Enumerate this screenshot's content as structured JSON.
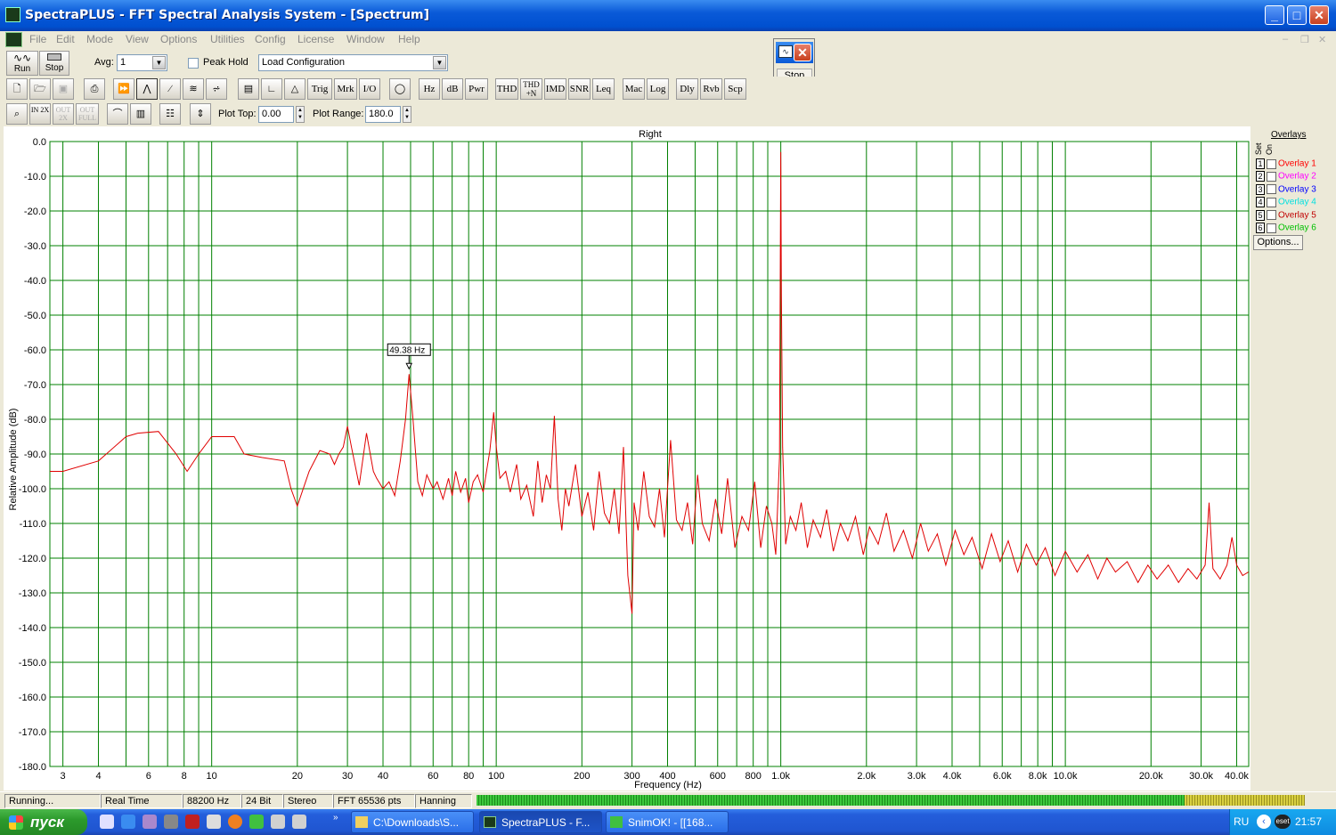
{
  "window": {
    "title": "SpectraPLUS - FFT Spectral Analysis System - [Spectrum]"
  },
  "menu": [
    "File",
    "Edit",
    "Mode",
    "View",
    "Options",
    "Utilities",
    "Config",
    "License",
    "Window",
    "Help"
  ],
  "toolbar1": {
    "run_label": "Run",
    "stop_label": "Stop",
    "avg_label": "Avg:",
    "avg_value": "1",
    "peak_hold_label": "Peak Hold",
    "config_value": "Load Configuration"
  },
  "toolbar2_buttons": [
    "Trig",
    "Mrk",
    "I/O",
    "Hz",
    "dB",
    "Pwr",
    "THD",
    "THD +N",
    "IMD",
    "SNR",
    "Leq",
    "Mac",
    "Log",
    "Dly",
    "Rvb",
    "Scp"
  ],
  "toolbar3": {
    "zoom_buttons": [
      "IN 2X",
      "OUT 2X",
      "OUT FULL"
    ],
    "plot_top_label": "Plot Top:",
    "plot_top_value": "0.00",
    "plot_range_label": "Plot Range:",
    "plot_range_value": "180.0"
  },
  "floating_stop": {
    "label": "Stop"
  },
  "overlays": {
    "header": "Overlays",
    "set_label": "Set",
    "on_label": "On",
    "items": [
      {
        "num": "1",
        "label": "Overlay 1",
        "color": "#ff0000"
      },
      {
        "num": "2",
        "label": "Overlay 2",
        "color": "#ff00ff"
      },
      {
        "num": "3",
        "label": "Overlay 3",
        "color": "#0000ff"
      },
      {
        "num": "4",
        "label": "Overlay 4",
        "color": "#00e0e0"
      },
      {
        "num": "5",
        "label": "Overlay 5",
        "color": "#c00000"
      },
      {
        "num": "6",
        "label": "Overlay 6",
        "color": "#00c000"
      }
    ],
    "options_label": "Options..."
  },
  "chart_data": {
    "type": "line",
    "title": "Right",
    "xlabel": "Frequency (Hz)",
    "ylabel": "Relative Amplitude (dB)",
    "xscale": "log",
    "xlim": [
      2.7,
      44100
    ],
    "ylim": [
      -180,
      0
    ],
    "grid": true,
    "grid_color": "#008000",
    "y_ticks": [
      "0.0",
      "-10.0",
      "-20.0",
      "-30.0",
      "-40.0",
      "-50.0",
      "-60.0",
      "-70.0",
      "-80.0",
      "-90.0",
      "-100.0",
      "-110.0",
      "-120.0",
      "-130.0",
      "-140.0",
      "-150.0",
      "-160.0",
      "-170.0",
      "-180.0"
    ],
    "x_ticks": [
      {
        "v": 3,
        "t": "3"
      },
      {
        "v": 4,
        "t": "4"
      },
      {
        "v": 6,
        "t": "6"
      },
      {
        "v": 8,
        "t": "8"
      },
      {
        "v": 10,
        "t": "10"
      },
      {
        "v": 20,
        "t": "20"
      },
      {
        "v": 30,
        "t": "30"
      },
      {
        "v": 40,
        "t": "40"
      },
      {
        "v": 60,
        "t": "60"
      },
      {
        "v": 80,
        "t": "80"
      },
      {
        "v": 100,
        "t": "100"
      },
      {
        "v": 200,
        "t": "200"
      },
      {
        "v": 300,
        "t": "300"
      },
      {
        "v": 400,
        "t": "400"
      },
      {
        "v": 600,
        "t": "600"
      },
      {
        "v": 800,
        "t": "800"
      },
      {
        "v": 1000,
        "t": "1.0k"
      },
      {
        "v": 2000,
        "t": "2.0k"
      },
      {
        "v": 3000,
        "t": "3.0k"
      },
      {
        "v": 4000,
        "t": "4.0k"
      },
      {
        "v": 6000,
        "t": "6.0k"
      },
      {
        "v": 8000,
        "t": "8.0k"
      },
      {
        "v": 10000,
        "t": "10.0k"
      },
      {
        "v": 20000,
        "t": "20.0k"
      },
      {
        "v": 30000,
        "t": "30.0k"
      },
      {
        "v": 40000,
        "t": "40.0k"
      }
    ],
    "marker": {
      "label": "49.38 Hz",
      "x": 49.38,
      "y": -67
    },
    "series": [
      {
        "color": "#e00000",
        "points": [
          [
            2.7,
            -95
          ],
          [
            3.0,
            -95
          ],
          [
            4.0,
            -92
          ],
          [
            5.0,
            -85
          ],
          [
            5.5,
            -84
          ],
          [
            6.5,
            -83.5
          ],
          [
            7.5,
            -90
          ],
          [
            8.2,
            -95
          ],
          [
            9.0,
            -90
          ],
          [
            10,
            -85
          ],
          [
            12,
            -85
          ],
          [
            13,
            -90
          ],
          [
            15,
            -91
          ],
          [
            18,
            -92
          ],
          [
            19,
            -100
          ],
          [
            20,
            -105
          ],
          [
            22,
            -95
          ],
          [
            24,
            -89
          ],
          [
            26,
            -90
          ],
          [
            27,
            -93
          ],
          [
            28,
            -90
          ],
          [
            29,
            -88
          ],
          [
            30,
            -82
          ],
          [
            31,
            -88
          ],
          [
            33,
            -99
          ],
          [
            35,
            -84
          ],
          [
            37,
            -95
          ],
          [
            38,
            -97
          ],
          [
            40,
            -100
          ],
          [
            42,
            -98
          ],
          [
            44,
            -102
          ],
          [
            46,
            -92
          ],
          [
            48,
            -80
          ],
          [
            49.4,
            -67
          ],
          [
            51,
            -80
          ],
          [
            53,
            -98
          ],
          [
            55,
            -102
          ],
          [
            57,
            -96
          ],
          [
            60,
            -100
          ],
          [
            62,
            -98
          ],
          [
            65,
            -103
          ],
          [
            68,
            -97
          ],
          [
            70,
            -102
          ],
          [
            72,
            -95
          ],
          [
            75,
            -101
          ],
          [
            78,
            -97
          ],
          [
            80,
            -104
          ],
          [
            83,
            -98
          ],
          [
            86,
            -96
          ],
          [
            90,
            -101
          ],
          [
            95,
            -89
          ],
          [
            98,
            -78
          ],
          [
            100,
            -88
          ],
          [
            103,
            -97
          ],
          [
            108,
            -95
          ],
          [
            112,
            -101
          ],
          [
            118,
            -93
          ],
          [
            122,
            -103
          ],
          [
            128,
            -99
          ],
          [
            135,
            -108
          ],
          [
            140,
            -92
          ],
          [
            145,
            -104
          ],
          [
            150,
            -96
          ],
          [
            155,
            -100
          ],
          [
            160,
            -79
          ],
          [
            165,
            -103
          ],
          [
            170,
            -112
          ],
          [
            175,
            -100
          ],
          [
            180,
            -105
          ],
          [
            190,
            -93
          ],
          [
            200,
            -108
          ],
          [
            210,
            -101
          ],
          [
            220,
            -112
          ],
          [
            230,
            -95
          ],
          [
            240,
            -107
          ],
          [
            250,
            -110
          ],
          [
            260,
            -100
          ],
          [
            270,
            -113
          ],
          [
            280,
            -88
          ],
          [
            290,
            -125
          ],
          [
            300,
            -136
          ],
          [
            305,
            -104
          ],
          [
            315,
            -112
          ],
          [
            330,
            -95
          ],
          [
            345,
            -108
          ],
          [
            360,
            -111
          ],
          [
            375,
            -100
          ],
          [
            390,
            -114
          ],
          [
            410,
            -86
          ],
          [
            430,
            -109
          ],
          [
            450,
            -112
          ],
          [
            470,
            -104
          ],
          [
            490,
            -116
          ],
          [
            510,
            -96
          ],
          [
            530,
            -110
          ],
          [
            560,
            -115
          ],
          [
            590,
            -103
          ],
          [
            620,
            -113
          ],
          [
            650,
            -97
          ],
          [
            690,
            -117
          ],
          [
            730,
            -108
          ],
          [
            770,
            -112
          ],
          [
            810,
            -98
          ],
          [
            850,
            -117
          ],
          [
            890,
            -105
          ],
          [
            930,
            -110
          ],
          [
            960,
            -119
          ],
          [
            990,
            -91
          ],
          [
            1000,
            -3
          ],
          [
            1005,
            -44
          ],
          [
            1015,
            -88
          ],
          [
            1040,
            -116
          ],
          [
            1080,
            -108
          ],
          [
            1130,
            -112
          ],
          [
            1180,
            -104
          ],
          [
            1240,
            -117
          ],
          [
            1300,
            -109
          ],
          [
            1380,
            -114
          ],
          [
            1450,
            -106
          ],
          [
            1530,
            -118
          ],
          [
            1620,
            -110
          ],
          [
            1720,
            -115
          ],
          [
            1830,
            -108
          ],
          [
            1950,
            -119
          ],
          [
            2050,
            -111
          ],
          [
            2200,
            -116
          ],
          [
            2350,
            -107
          ],
          [
            2500,
            -118
          ],
          [
            2700,
            -112
          ],
          [
            2900,
            -120
          ],
          [
            3100,
            -110
          ],
          [
            3300,
            -118
          ],
          [
            3550,
            -113
          ],
          [
            3800,
            -122
          ],
          [
            4100,
            -112
          ],
          [
            4400,
            -119
          ],
          [
            4700,
            -114
          ],
          [
            5100,
            -123
          ],
          [
            5500,
            -113
          ],
          [
            5900,
            -121
          ],
          [
            6300,
            -115
          ],
          [
            6800,
            -124
          ],
          [
            7300,
            -116
          ],
          [
            7900,
            -122
          ],
          [
            8500,
            -117
          ],
          [
            9200,
            -125
          ],
          [
            10000,
            -118
          ],
          [
            11000,
            -124
          ],
          [
            12000,
            -119
          ],
          [
            13000,
            -126
          ],
          [
            14000,
            -120
          ],
          [
            15000,
            -124
          ],
          [
            16500,
            -121
          ],
          [
            18000,
            -127
          ],
          [
            19500,
            -122
          ],
          [
            21000,
            -126
          ],
          [
            23000,
            -122
          ],
          [
            25000,
            -127
          ],
          [
            27000,
            -123
          ],
          [
            29000,
            -126
          ],
          [
            31000,
            -122
          ],
          [
            32000,
            -104
          ],
          [
            33000,
            -123
          ],
          [
            35000,
            -126
          ],
          [
            37000,
            -122
          ],
          [
            38500,
            -114
          ],
          [
            40000,
            -122
          ],
          [
            42000,
            -125
          ],
          [
            44000,
            -124
          ]
        ]
      }
    ]
  },
  "status": {
    "state": "Running...",
    "mode": "Real Time",
    "rate": "88200 Hz",
    "bits": "24 Bit",
    "channels": "Stereo",
    "fft": "FFT 65536 pts",
    "window": "Hanning"
  },
  "taskbar": {
    "start_label": "пуск",
    "tasks": [
      {
        "label": "C:\\Downloads\\S...",
        "active": false
      },
      {
        "label": "SpectraPLUS - F...",
        "active": true
      },
      {
        "label": "SnimOK! - [[168...",
        "active": false
      }
    ],
    "lang": "RU",
    "clock": "21:57"
  }
}
